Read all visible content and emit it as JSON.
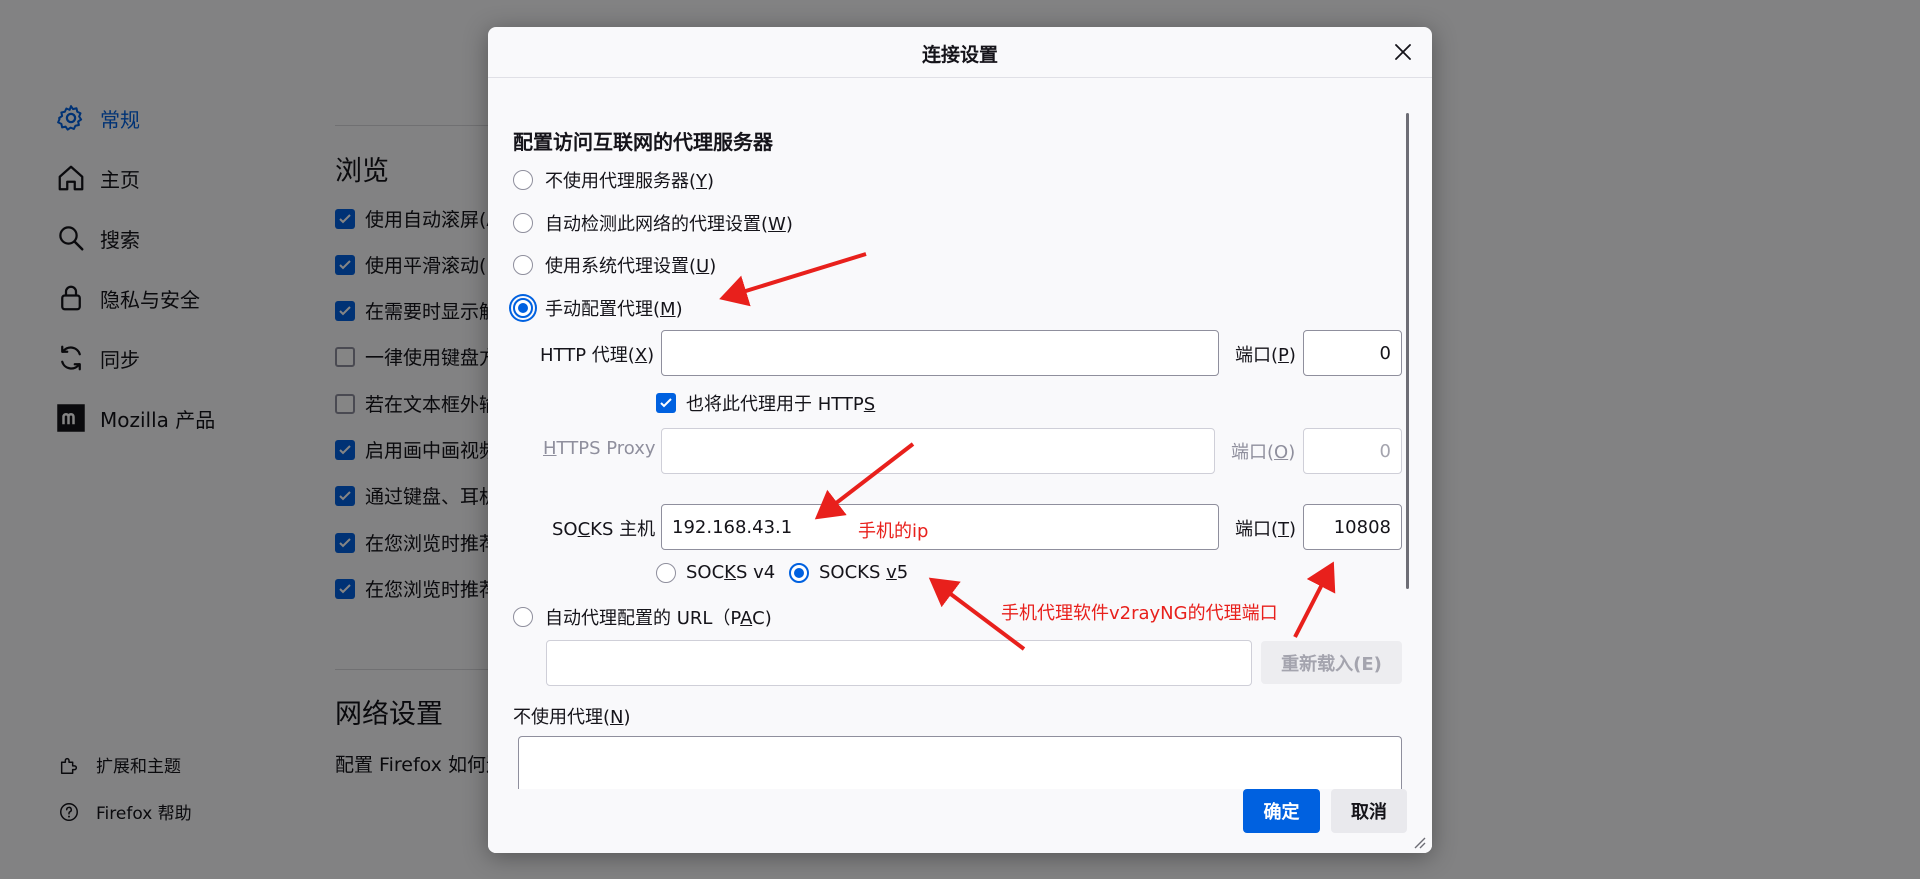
{
  "background": {
    "sidebar": {
      "categories": [
        {
          "label": "常规",
          "icon": "gear-icon"
        },
        {
          "label": "主页",
          "icon": "home-icon"
        },
        {
          "label": "搜索",
          "icon": "search-icon"
        },
        {
          "label": "隐私与安全",
          "icon": "lock-icon"
        },
        {
          "label": "同步",
          "icon": "sync-icon"
        },
        {
          "label": "Mozilla 产品",
          "icon": "mozilla-icon"
        }
      ],
      "footer": [
        {
          "label": "扩展和主题",
          "icon": "puzzle-icon"
        },
        {
          "label": "Firefox 帮助",
          "icon": "help-icon"
        }
      ]
    },
    "browsing": {
      "title": "浏览",
      "options": [
        {
          "label": "使用自动滚屏(A",
          "checked": true
        },
        {
          "label": "使用平滑滚动(M",
          "checked": true
        },
        {
          "label": "在需要时显示触",
          "checked": true
        },
        {
          "label": "一律使用键盘方",
          "checked": false
        },
        {
          "label": "若在文本框外输",
          "checked": false
        },
        {
          "label": "启用画中画视频",
          "checked": true
        },
        {
          "label": "通过键盘、耳机",
          "checked": true
        },
        {
          "label": "在您浏览时推荐",
          "checked": true
        },
        {
          "label": "在您浏览时推荐",
          "checked": true
        }
      ]
    },
    "network": {
      "title": "网络设置",
      "desc": "配置 Firefox 如何连"
    }
  },
  "dialog": {
    "title": "连接设置",
    "heading": "配置访问互联网的代理服务器",
    "proxy_options": {
      "none": {
        "text": "不使用代理服务器(",
        "key": "Y",
        "end": ")"
      },
      "auto_detect": {
        "text": "自动检测此网络的代理设置(",
        "key": "W",
        "end": ")"
      },
      "system": {
        "text": "使用系统代理设置(",
        "key": "U",
        "end": ")"
      },
      "manual": {
        "text": "手动配置代理(",
        "key": "M",
        "end": ")"
      },
      "pac": {
        "text": "自动代理配置的 URL（P",
        "key": "A",
        "end": "C)"
      },
      "selected": "manual"
    },
    "http": {
      "label": "HTTP 代理(",
      "key": "X",
      "end": ")",
      "value": "",
      "port_label": "端口(",
      "port_key": "P",
      "port_end": ")",
      "port": "0"
    },
    "also_https": {
      "label": "也将此代理用于 HTTP",
      "key": "S",
      "checked": true
    },
    "https": {
      "key": "H",
      "label": "TTPS Proxy",
      "value": "",
      "port_label": "端口(",
      "port_key": "O",
      "port_end": ")",
      "port": "0"
    },
    "socks": {
      "label_pre": "SO",
      "key": "C",
      "label_post": "KS 主机",
      "value": "192.168.43.1",
      "port_label": "端口(",
      "port_key": "T",
      "port_end": ")",
      "port": "10808"
    },
    "socks_version": {
      "v4_pre": "SOC",
      "v4_key": "K",
      "v4_post": "S v4",
      "v5_pre": "SOCKS ",
      "v5_key": "v",
      "v5_post": "5",
      "selected": "v5"
    },
    "pac_url": "",
    "reload_button": "重新载入(E)",
    "no_proxy": {
      "text": "不使用代理(",
      "key": "N",
      "end": ")",
      "value": ""
    },
    "ok_button": "确定",
    "cancel_button": "取消",
    "annotations": {
      "phone_ip": "手机的ip",
      "proxy_port": "手机代理软件v2rayNG的代理端口"
    },
    "colors": {
      "accent": "#0061e0",
      "annotation": "#e8201c"
    }
  }
}
